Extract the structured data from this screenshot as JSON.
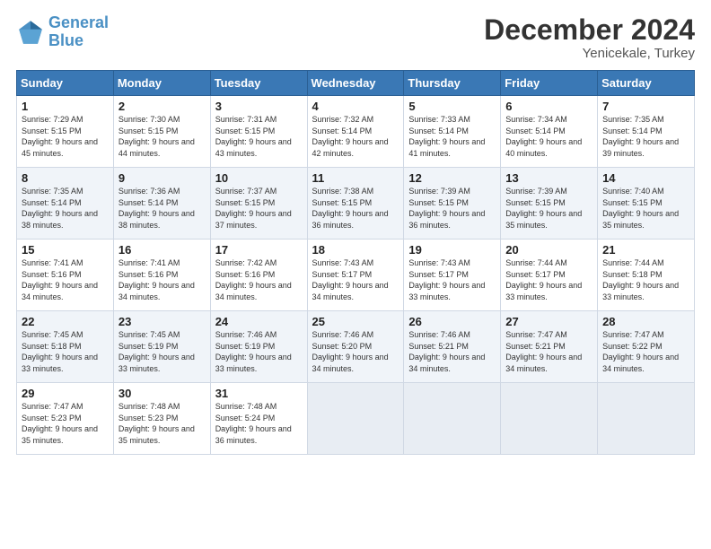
{
  "header": {
    "logo_line1": "General",
    "logo_line2": "Blue",
    "month": "December 2024",
    "location": "Yenicekale, Turkey"
  },
  "weekdays": [
    "Sunday",
    "Monday",
    "Tuesday",
    "Wednesday",
    "Thursday",
    "Friday",
    "Saturday"
  ],
  "weeks": [
    [
      {
        "day": "1",
        "sunrise": "Sunrise: 7:29 AM",
        "sunset": "Sunset: 5:15 PM",
        "daylight": "Daylight: 9 hours and 45 minutes."
      },
      {
        "day": "2",
        "sunrise": "Sunrise: 7:30 AM",
        "sunset": "Sunset: 5:15 PM",
        "daylight": "Daylight: 9 hours and 44 minutes."
      },
      {
        "day": "3",
        "sunrise": "Sunrise: 7:31 AM",
        "sunset": "Sunset: 5:15 PM",
        "daylight": "Daylight: 9 hours and 43 minutes."
      },
      {
        "day": "4",
        "sunrise": "Sunrise: 7:32 AM",
        "sunset": "Sunset: 5:14 PM",
        "daylight": "Daylight: 9 hours and 42 minutes."
      },
      {
        "day": "5",
        "sunrise": "Sunrise: 7:33 AM",
        "sunset": "Sunset: 5:14 PM",
        "daylight": "Daylight: 9 hours and 41 minutes."
      },
      {
        "day": "6",
        "sunrise": "Sunrise: 7:34 AM",
        "sunset": "Sunset: 5:14 PM",
        "daylight": "Daylight: 9 hours and 40 minutes."
      },
      {
        "day": "7",
        "sunrise": "Sunrise: 7:35 AM",
        "sunset": "Sunset: 5:14 PM",
        "daylight": "Daylight: 9 hours and 39 minutes."
      }
    ],
    [
      {
        "day": "8",
        "sunrise": "Sunrise: 7:35 AM",
        "sunset": "Sunset: 5:14 PM",
        "daylight": "Daylight: 9 hours and 38 minutes."
      },
      {
        "day": "9",
        "sunrise": "Sunrise: 7:36 AM",
        "sunset": "Sunset: 5:14 PM",
        "daylight": "Daylight: 9 hours and 38 minutes."
      },
      {
        "day": "10",
        "sunrise": "Sunrise: 7:37 AM",
        "sunset": "Sunset: 5:15 PM",
        "daylight": "Daylight: 9 hours and 37 minutes."
      },
      {
        "day": "11",
        "sunrise": "Sunrise: 7:38 AM",
        "sunset": "Sunset: 5:15 PM",
        "daylight": "Daylight: 9 hours and 36 minutes."
      },
      {
        "day": "12",
        "sunrise": "Sunrise: 7:39 AM",
        "sunset": "Sunset: 5:15 PM",
        "daylight": "Daylight: 9 hours and 36 minutes."
      },
      {
        "day": "13",
        "sunrise": "Sunrise: 7:39 AM",
        "sunset": "Sunset: 5:15 PM",
        "daylight": "Daylight: 9 hours and 35 minutes."
      },
      {
        "day": "14",
        "sunrise": "Sunrise: 7:40 AM",
        "sunset": "Sunset: 5:15 PM",
        "daylight": "Daylight: 9 hours and 35 minutes."
      }
    ],
    [
      {
        "day": "15",
        "sunrise": "Sunrise: 7:41 AM",
        "sunset": "Sunset: 5:16 PM",
        "daylight": "Daylight: 9 hours and 34 minutes."
      },
      {
        "day": "16",
        "sunrise": "Sunrise: 7:41 AM",
        "sunset": "Sunset: 5:16 PM",
        "daylight": "Daylight: 9 hours and 34 minutes."
      },
      {
        "day": "17",
        "sunrise": "Sunrise: 7:42 AM",
        "sunset": "Sunset: 5:16 PM",
        "daylight": "Daylight: 9 hours and 34 minutes."
      },
      {
        "day": "18",
        "sunrise": "Sunrise: 7:43 AM",
        "sunset": "Sunset: 5:17 PM",
        "daylight": "Daylight: 9 hours and 34 minutes."
      },
      {
        "day": "19",
        "sunrise": "Sunrise: 7:43 AM",
        "sunset": "Sunset: 5:17 PM",
        "daylight": "Daylight: 9 hours and 33 minutes."
      },
      {
        "day": "20",
        "sunrise": "Sunrise: 7:44 AM",
        "sunset": "Sunset: 5:17 PM",
        "daylight": "Daylight: 9 hours and 33 minutes."
      },
      {
        "day": "21",
        "sunrise": "Sunrise: 7:44 AM",
        "sunset": "Sunset: 5:18 PM",
        "daylight": "Daylight: 9 hours and 33 minutes."
      }
    ],
    [
      {
        "day": "22",
        "sunrise": "Sunrise: 7:45 AM",
        "sunset": "Sunset: 5:18 PM",
        "daylight": "Daylight: 9 hours and 33 minutes."
      },
      {
        "day": "23",
        "sunrise": "Sunrise: 7:45 AM",
        "sunset": "Sunset: 5:19 PM",
        "daylight": "Daylight: 9 hours and 33 minutes."
      },
      {
        "day": "24",
        "sunrise": "Sunrise: 7:46 AM",
        "sunset": "Sunset: 5:19 PM",
        "daylight": "Daylight: 9 hours and 33 minutes."
      },
      {
        "day": "25",
        "sunrise": "Sunrise: 7:46 AM",
        "sunset": "Sunset: 5:20 PM",
        "daylight": "Daylight: 9 hours and 34 minutes."
      },
      {
        "day": "26",
        "sunrise": "Sunrise: 7:46 AM",
        "sunset": "Sunset: 5:21 PM",
        "daylight": "Daylight: 9 hours and 34 minutes."
      },
      {
        "day": "27",
        "sunrise": "Sunrise: 7:47 AM",
        "sunset": "Sunset: 5:21 PM",
        "daylight": "Daylight: 9 hours and 34 minutes."
      },
      {
        "day": "28",
        "sunrise": "Sunrise: 7:47 AM",
        "sunset": "Sunset: 5:22 PM",
        "daylight": "Daylight: 9 hours and 34 minutes."
      }
    ],
    [
      {
        "day": "29",
        "sunrise": "Sunrise: 7:47 AM",
        "sunset": "Sunset: 5:23 PM",
        "daylight": "Daylight: 9 hours and 35 minutes."
      },
      {
        "day": "30",
        "sunrise": "Sunrise: 7:48 AM",
        "sunset": "Sunset: 5:23 PM",
        "daylight": "Daylight: 9 hours and 35 minutes."
      },
      {
        "day": "31",
        "sunrise": "Sunrise: 7:48 AM",
        "sunset": "Sunset: 5:24 PM",
        "daylight": "Daylight: 9 hours and 36 minutes."
      },
      null,
      null,
      null,
      null
    ]
  ]
}
